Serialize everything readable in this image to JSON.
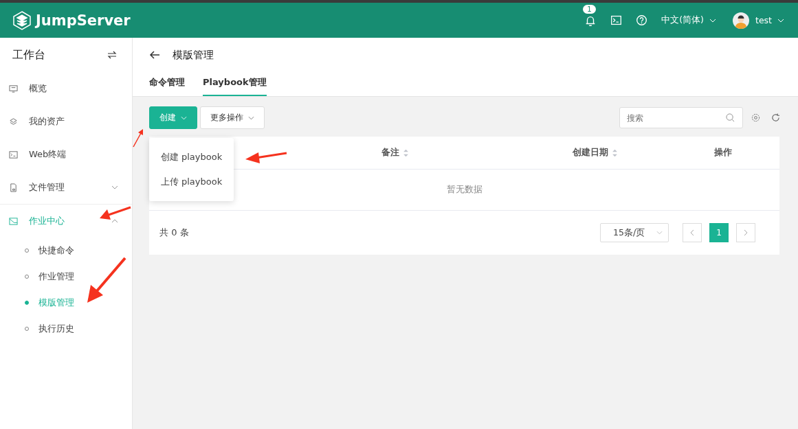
{
  "header": {
    "logo": "JumpServer",
    "notification_count": "1",
    "language": "中文(简体)",
    "user": "test"
  },
  "sidebar": {
    "title": "工作台",
    "items": [
      {
        "label": "概览",
        "selected": false
      },
      {
        "label": "我的资产",
        "selected": false
      },
      {
        "label": "Web终端",
        "selected": false
      },
      {
        "label": "文件管理",
        "selected": false,
        "expanded": false
      },
      {
        "label": "作业中心",
        "selected": true,
        "expanded": true,
        "children": [
          {
            "label": "快捷命令",
            "selected": false
          },
          {
            "label": "作业管理",
            "selected": false
          },
          {
            "label": "模版管理",
            "selected": true
          },
          {
            "label": "执行历史",
            "selected": false
          }
        ]
      }
    ]
  },
  "page": {
    "title": "模版管理",
    "tabs": [
      {
        "label": "命令管理",
        "selected": false
      },
      {
        "label": "Playbook管理",
        "selected": true
      }
    ]
  },
  "toolbar": {
    "create_button": "创建",
    "more_button": "更多操作",
    "search": {
      "placeholder": "搜索"
    }
  },
  "create_menu": [
    "创建 playbook",
    "上传 playbook"
  ],
  "table": {
    "columns": [
      {
        "label": "备注",
        "sortable": true
      },
      {
        "label": "创建日期",
        "sortable": true
      },
      {
        "label": "操作",
        "sortable": false
      }
    ],
    "empty_text": "暂无数据"
  },
  "footer": {
    "total": "共 0 条",
    "page_size": "15条/页",
    "pages": [
      {
        "label": "1",
        "selected": true
      }
    ]
  }
}
